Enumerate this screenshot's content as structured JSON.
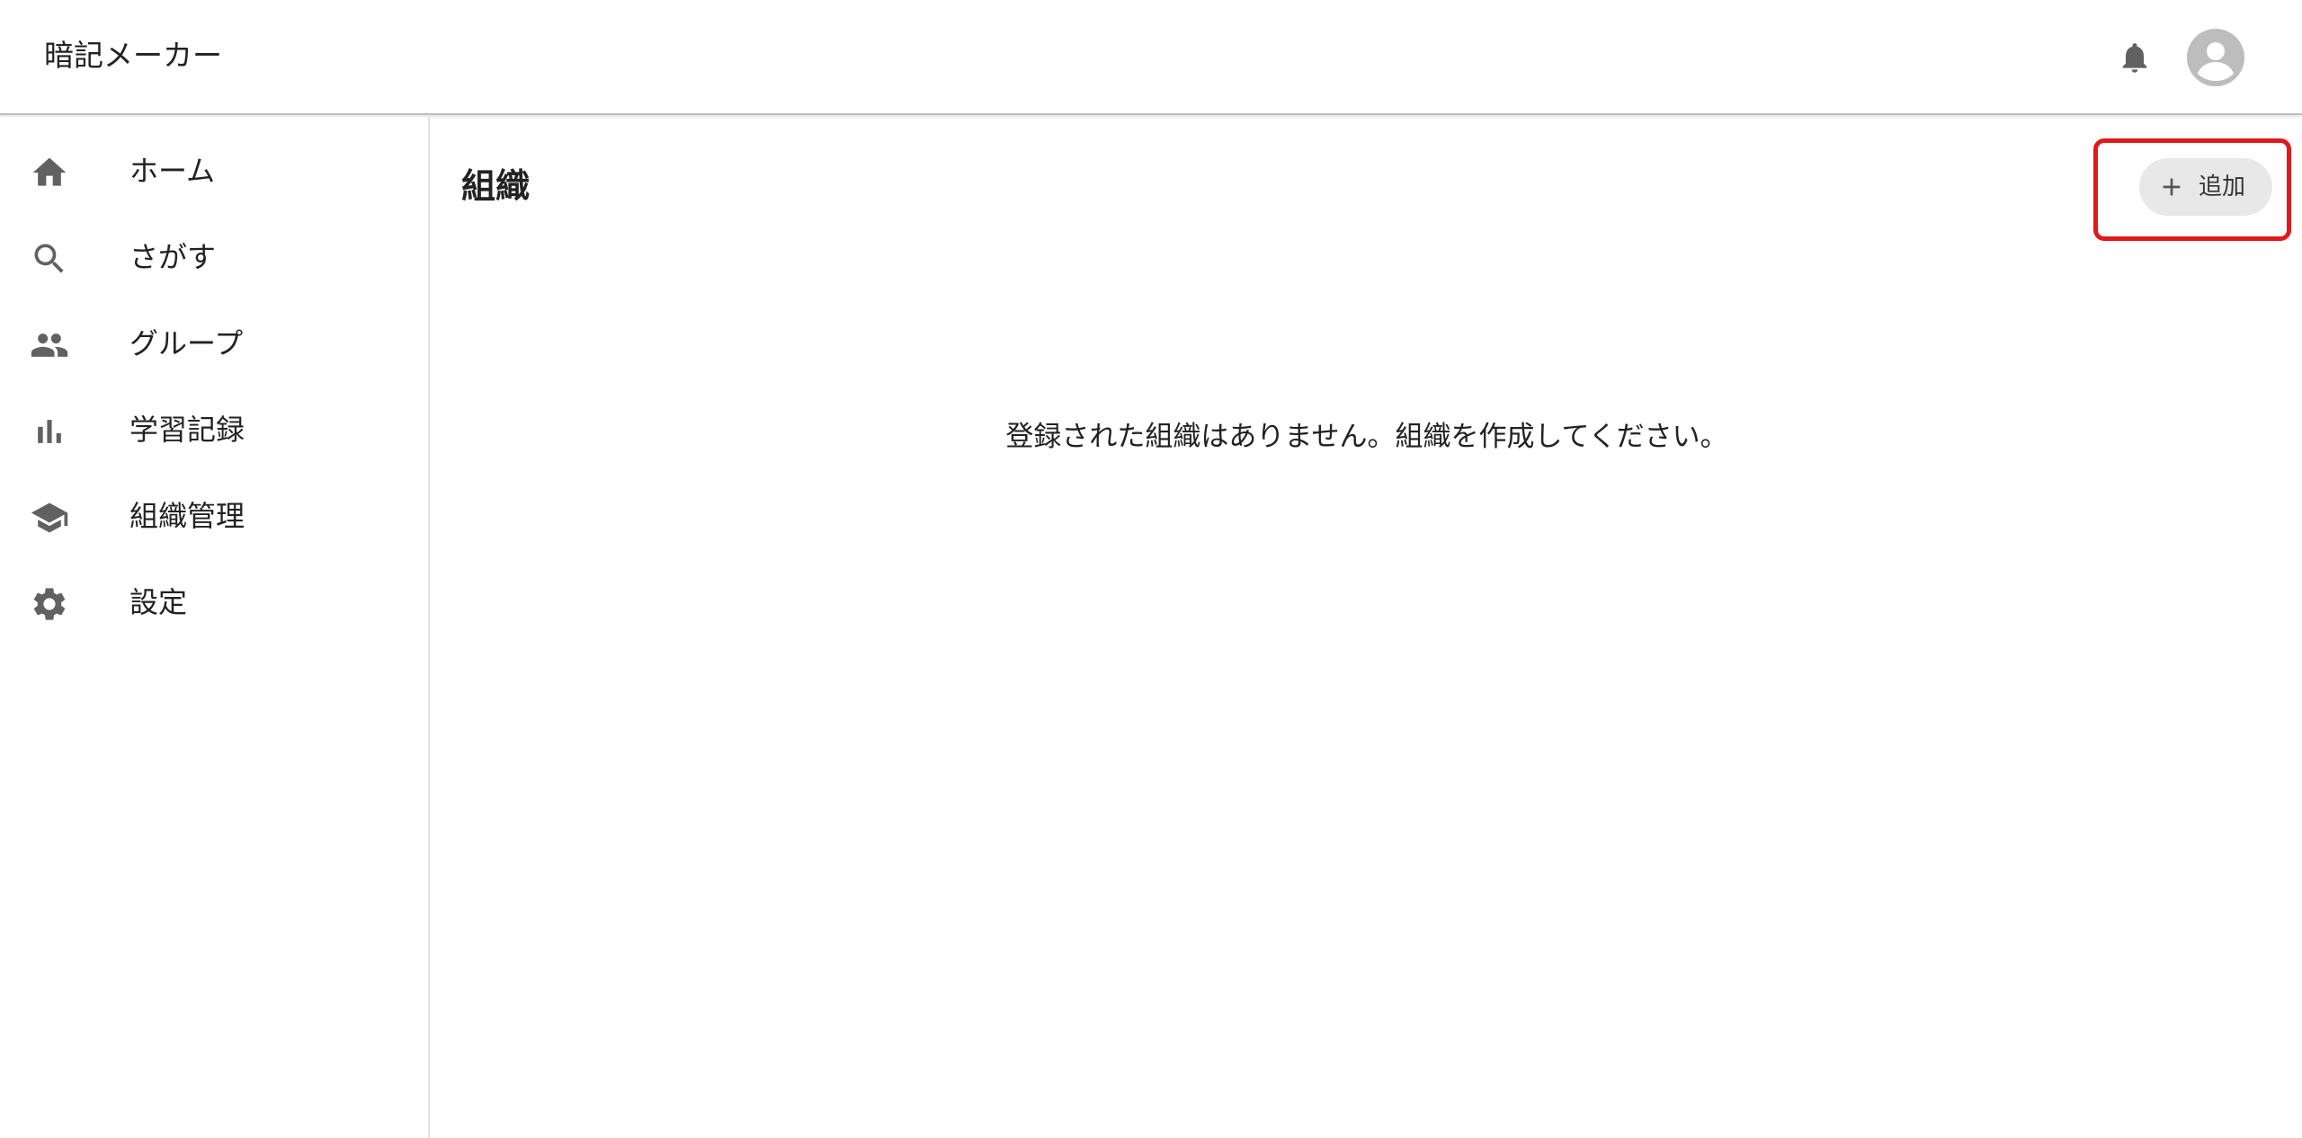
{
  "header": {
    "app_title": "暗記メーカー",
    "icons": [
      "bell-icon",
      "account-circle-icon"
    ]
  },
  "sidebar": {
    "items": [
      {
        "label": "ホーム",
        "icon": "home-icon"
      },
      {
        "label": "さがす",
        "icon": "search-icon"
      },
      {
        "label": "グループ",
        "icon": "people-icon"
      },
      {
        "label": "学習記録",
        "icon": "bar-chart-icon"
      },
      {
        "label": "組織管理",
        "icon": "school-icon"
      },
      {
        "label": "設定",
        "icon": "gear-icon"
      }
    ]
  },
  "main": {
    "title": "組織",
    "add_button_label": "追加",
    "empty_message": "登録された組織はありません。組織を作成してください。"
  },
  "colors": {
    "icon": "#616161",
    "avatar_bg": "#bdbdbd",
    "button_bg": "#e8e8e8",
    "highlight": "#e0191c"
  }
}
